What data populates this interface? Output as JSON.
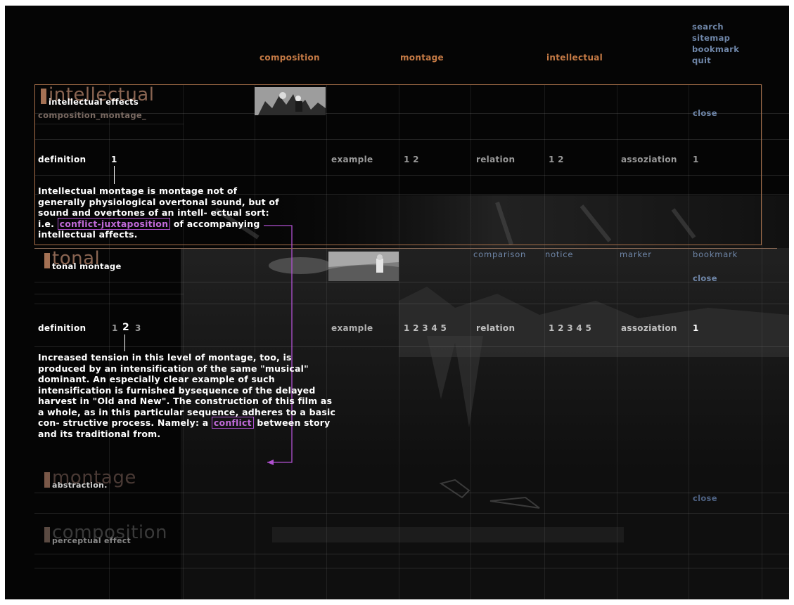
{
  "menu": {
    "tabs": [
      {
        "label": "composition",
        "color": "#c57a45"
      },
      {
        "label": "montage",
        "color": "#c57a45"
      },
      {
        "label": "intellectual",
        "color": "#c57a45"
      }
    ],
    "side": [
      "search",
      "sitemap",
      "bookmark",
      "quit"
    ]
  },
  "panel_intellectual": {
    "big_title": "intellectual",
    "subtitle": "intellectual effects",
    "path": "composition_montage_",
    "close": "close",
    "definition_label": "definition",
    "definition_pages": [
      "1"
    ],
    "example_label": "example",
    "example_pages": "1 2",
    "relation_label": "relation",
    "relation_pages": "1 2",
    "assoziation_label": "assoziation",
    "assoziation_pages": "1",
    "text_before": "Intellectual montage is montage not of generally physiological overtonal sound, but of sound and overtones of an intell- ectual sort: i.e.",
    "highlight": "conflict-juxtaposition",
    "text_after": "of accompanying intellectual affects."
  },
  "panel_tonal": {
    "big_title": "tonal",
    "subtitle": "tonal montage",
    "tools": [
      "comparison",
      "notice",
      "marker",
      "bookmark"
    ],
    "close": "close",
    "definition_label": "definition",
    "definition_pages": [
      "1",
      "2",
      "3"
    ],
    "active_page": "2",
    "example_label": "example",
    "example_pages": "1 2 3 4 5",
    "relation_label": "relation",
    "relation_pages": "1 2 3 4 5",
    "assoziation_label": "assoziation",
    "assoziation_pages": "1",
    "text_before": "Increased tension in this level of montage, too, is produced by an intensification of the same \"musical\" dominant. An especially clear example of such intensification is furnished bysequence of the delayed harvest in \"Old and New\". The construction of this film as a whole, as in this particular sequence, adheres to a basic con- structive process. Namely: a",
    "highlight": "conflict",
    "text_after": "between story and its traditional from."
  },
  "panel_montage": {
    "big_title": "montage",
    "subtitle": "abstraction.",
    "close": "close"
  },
  "panel_composition": {
    "big_title": "composition",
    "subtitle": "perceptual effect"
  },
  "colors": {
    "accent_orange": "#c57a45",
    "link_blue": "#6f86a8",
    "highlight_purple": "#b050d0",
    "frame_border": "#a8704a"
  }
}
